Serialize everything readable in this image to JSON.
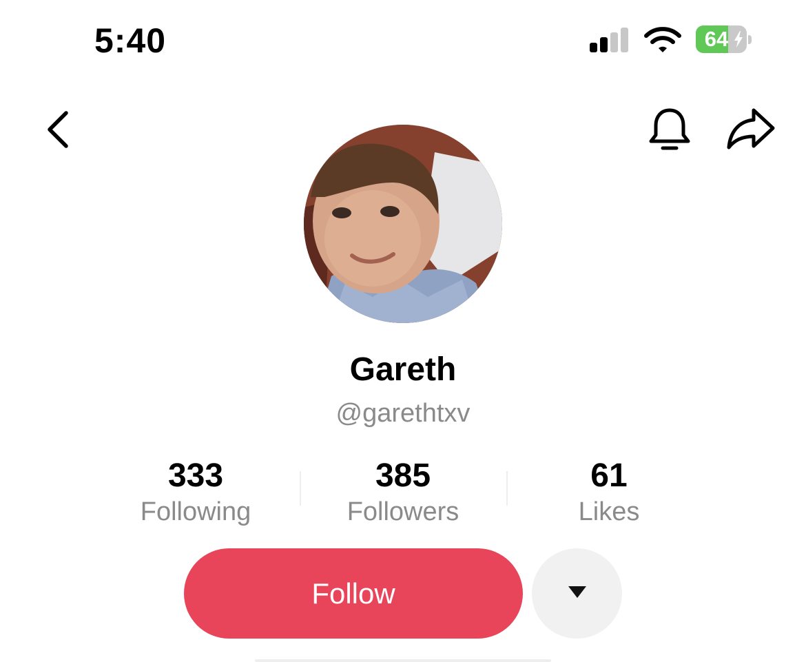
{
  "status_bar": {
    "time": "5:40",
    "battery_level": "64",
    "battery_fraction": 0.64,
    "battery_color": "#5fc856",
    "signal_bars_active": 2,
    "signal_bars_total": 4,
    "charging": true
  },
  "nav": {
    "back_icon": "chevron-left-icon",
    "notify_icon": "bell-icon",
    "share_icon": "share-arrow-icon"
  },
  "profile": {
    "display_name": "Gareth",
    "handle": "@garethtxv"
  },
  "stats": [
    {
      "value": "333",
      "label": "Following"
    },
    {
      "value": "385",
      "label": "Followers"
    },
    {
      "value": "61",
      "label": "Likes"
    }
  ],
  "actions": {
    "follow_label": "Follow",
    "follow_color": "#e8445a",
    "more_icon": "caret-down-icon"
  }
}
